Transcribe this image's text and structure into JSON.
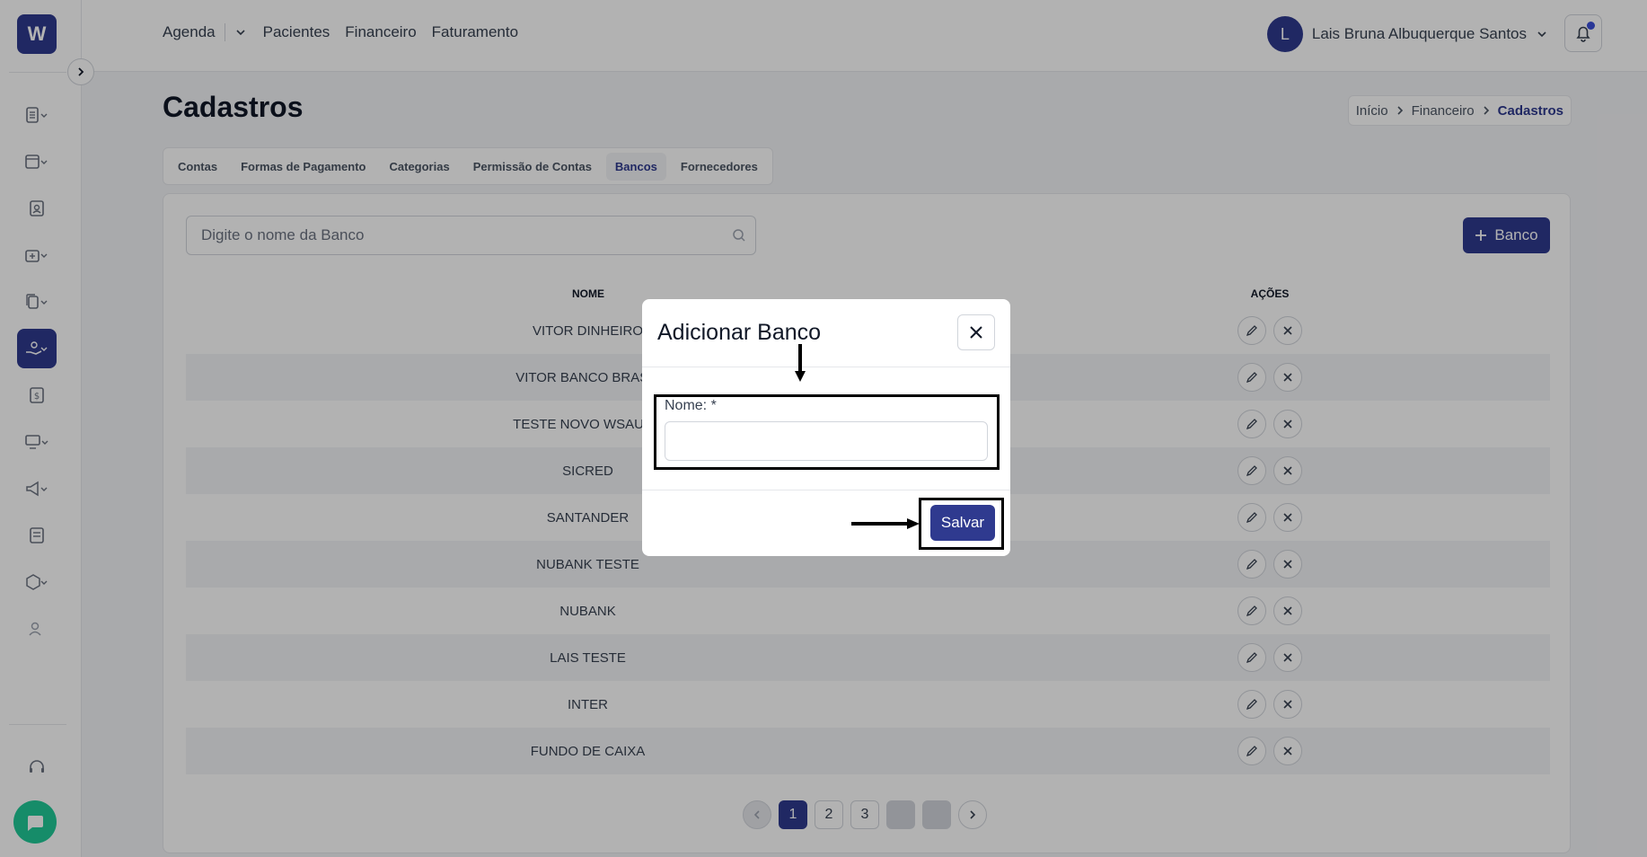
{
  "app": {
    "logo_letter": "W"
  },
  "topnav": {
    "items": [
      "Agenda",
      "Pacientes",
      "Financeiro",
      "Faturamento"
    ]
  },
  "user": {
    "initial": "L",
    "name": "Lais Bruna Albuquerque Santos"
  },
  "page": {
    "title": "Cadastros"
  },
  "breadcrumb": {
    "items": [
      "Início",
      "Financeiro",
      "Cadastros"
    ]
  },
  "tabs": [
    "Contas",
    "Formas de Pagamento",
    "Categorias",
    "Permissão de Contas",
    "Bancos",
    "Fornecedores"
  ],
  "search": {
    "placeholder": "Digite o nome da Banco"
  },
  "add_button": {
    "label": "Banco"
  },
  "table": {
    "headers": [
      "NOME",
      "AÇÕES"
    ],
    "rows": [
      "VITOR DINHEIRO",
      "VITOR BANCO BRASIL",
      "TESTE NOVO WSAUDE",
      "SICRED",
      "SANTANDER",
      "NUBANK TESTE",
      "NUBANK",
      "LAIS TESTE",
      "INTER",
      "FUNDO DE CAIXA"
    ]
  },
  "pagination": {
    "pages": [
      "1",
      "2",
      "3"
    ]
  },
  "modal": {
    "title": "Adicionar Banco",
    "field_label": "Nome: *",
    "field_value": "",
    "save_label": "Salvar"
  },
  "colors": {
    "primary": "#2f3a8f",
    "chat": "#20c997",
    "notification": "#3b4fd8"
  }
}
